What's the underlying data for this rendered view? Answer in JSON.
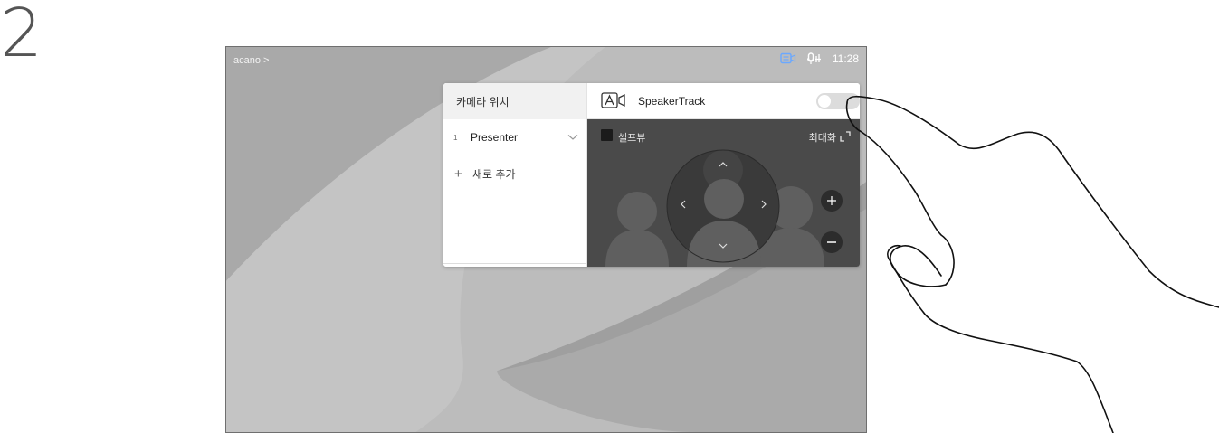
{
  "step": {
    "number": "2"
  },
  "status_bar": {
    "breadcrumb": "acano >",
    "time": "11:28",
    "icons": [
      "camera-control-icon",
      "mic-icon"
    ],
    "accent_color": "#6aa8ff"
  },
  "camera_panel": {
    "left_title": "카메라 위치",
    "presets": [
      {
        "number": "1",
        "label": "Presenter"
      }
    ],
    "add_new_label": "새로 추가",
    "speakertrack": {
      "label": "SpeakerTrack",
      "enabled": false
    },
    "selfview_label": "셀프뷰",
    "maximize_label": "최대화"
  },
  "colors": {
    "preview_bg": "#4a4a4a",
    "panel_bg": "#ffffff",
    "toggle_off": "#dcdcdc"
  }
}
